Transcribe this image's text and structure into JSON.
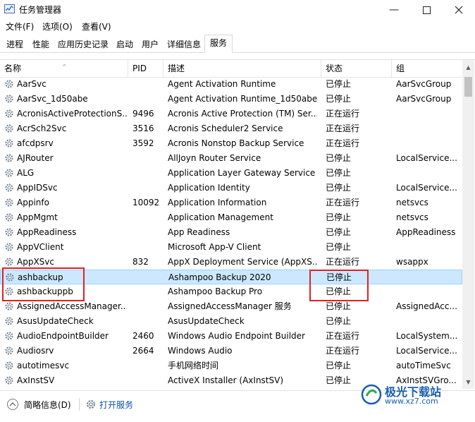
{
  "window": {
    "title": "任务管理器"
  },
  "menu": [
    "文件(F)",
    "选项(O)",
    "查看(V)"
  ],
  "tabs": [
    "进程",
    "性能",
    "应用历史记录",
    "启动",
    "用户",
    "详细信息",
    "服务"
  ],
  "active_tab": 6,
  "columns": {
    "name": "名称",
    "pid": "PID",
    "desc": "描述",
    "status": "状态",
    "group": "组"
  },
  "rows": [
    {
      "name": "AarSvc",
      "pid": "",
      "desc": "Agent Activation Runtime",
      "status": "已停止",
      "group": "AarSvcGroup"
    },
    {
      "name": "AarSvc_1d50abe",
      "pid": "",
      "desc": "Agent Activation Runtime_1d50abe",
      "status": "已停止",
      "group": "AarSvcGroup"
    },
    {
      "name": "AcronisActiveProtectionS...",
      "pid": "9496",
      "desc": "Acronis Active Protection (TM) Ser...",
      "status": "正在运行",
      "group": ""
    },
    {
      "name": "AcrSch2Svc",
      "pid": "3516",
      "desc": "Acronis Scheduler2 Service",
      "status": "正在运行",
      "group": ""
    },
    {
      "name": "afcdpsrv",
      "pid": "3592",
      "desc": "Acronis Nonstop Backup Service",
      "status": "正在运行",
      "group": ""
    },
    {
      "name": "AJRouter",
      "pid": "",
      "desc": "AllJoyn Router Service",
      "status": "已停止",
      "group": "LocalService..."
    },
    {
      "name": "ALG",
      "pid": "",
      "desc": "Application Layer Gateway Service",
      "status": "已停止",
      "group": ""
    },
    {
      "name": "AppIDSvc",
      "pid": "",
      "desc": "Application Identity",
      "status": "已停止",
      "group": "LocalService..."
    },
    {
      "name": "Appinfo",
      "pid": "10092",
      "desc": "Application Information",
      "status": "正在运行",
      "group": "netsvcs"
    },
    {
      "name": "AppMgmt",
      "pid": "",
      "desc": "Application Management",
      "status": "已停止",
      "group": "netsvcs"
    },
    {
      "name": "AppReadiness",
      "pid": "",
      "desc": "App Readiness",
      "status": "已停止",
      "group": "AppReadiness"
    },
    {
      "name": "AppVClient",
      "pid": "",
      "desc": "Microsoft App-V Client",
      "status": "已停止",
      "group": ""
    },
    {
      "name": "AppXSvc",
      "pid": "832",
      "desc": "AppX Deployment Service (AppXS...",
      "status": "正在运行",
      "group": "wsappx"
    },
    {
      "name": "ashbackup",
      "pid": "",
      "desc": "Ashampoo Backup 2020",
      "status": "已停止",
      "group": ""
    },
    {
      "name": "ashbackuppb",
      "pid": "",
      "desc": "Ashampoo Backup Pro",
      "status": "已停止",
      "group": ""
    },
    {
      "name": "AssignedAccessManager...",
      "pid": "",
      "desc": "AssignedAccessManager 服务",
      "status": "已停止",
      "group": "AssignedAcc..."
    },
    {
      "name": "AsusUpdateCheck",
      "pid": "",
      "desc": "AsusUpdateCheck",
      "status": "已停止",
      "group": ""
    },
    {
      "name": "AudioEndpointBuilder",
      "pid": "2460",
      "desc": "Windows Audio Endpoint Builder",
      "status": "正在运行",
      "group": "LocalSystem..."
    },
    {
      "name": "Audiosrv",
      "pid": "2664",
      "desc": "Windows Audio",
      "status": "正在运行",
      "group": "LocalService..."
    },
    {
      "name": "autotimesvc",
      "pid": "",
      "desc": "手机网络时间",
      "status": "已停止",
      "group": "autoTimeSvc"
    },
    {
      "name": "AxInstSV",
      "pid": "",
      "desc": "ActiveX Installer (AxInstSV)",
      "status": "已停止",
      "group": "AxInstSVGro..."
    }
  ],
  "selected_row": 13,
  "footer": {
    "fewer_details": "简略信息(D)",
    "open_services": "打开服务"
  },
  "watermark": {
    "brand": "极光下载站",
    "url": "www.xz7.com"
  }
}
